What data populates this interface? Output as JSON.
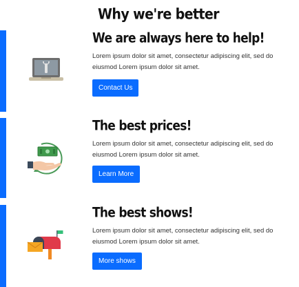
{
  "page": {
    "title": "Why we're better"
  },
  "colors": {
    "accent": "#0a6cff",
    "button_text": "#ffffff"
  },
  "features": [
    {
      "heading": "We are always here to help!",
      "description": "Lorem ipsum dolor sit amet, consectetur adipiscing elit, sed do eiusmod Lorem ipsum dolor sit amet.",
      "button_label": "Contact Us",
      "icon": "laptop-wrench-icon"
    },
    {
      "heading": "The best prices!",
      "description": "Lorem ipsum dolor sit amet, consectetur adipiscing elit, sed do eiusmod Lorem ipsum dolor sit amet.",
      "button_label": "Learn More",
      "icon": "money-hand-icon"
    },
    {
      "heading": "The best shows!",
      "description": "Lorem ipsum dolor sit amet, consectetur adipiscing elit, sed do eiusmod Lorem ipsum dolor sit amet.",
      "button_label": "More shows",
      "icon": "mailbox-icon"
    }
  ]
}
